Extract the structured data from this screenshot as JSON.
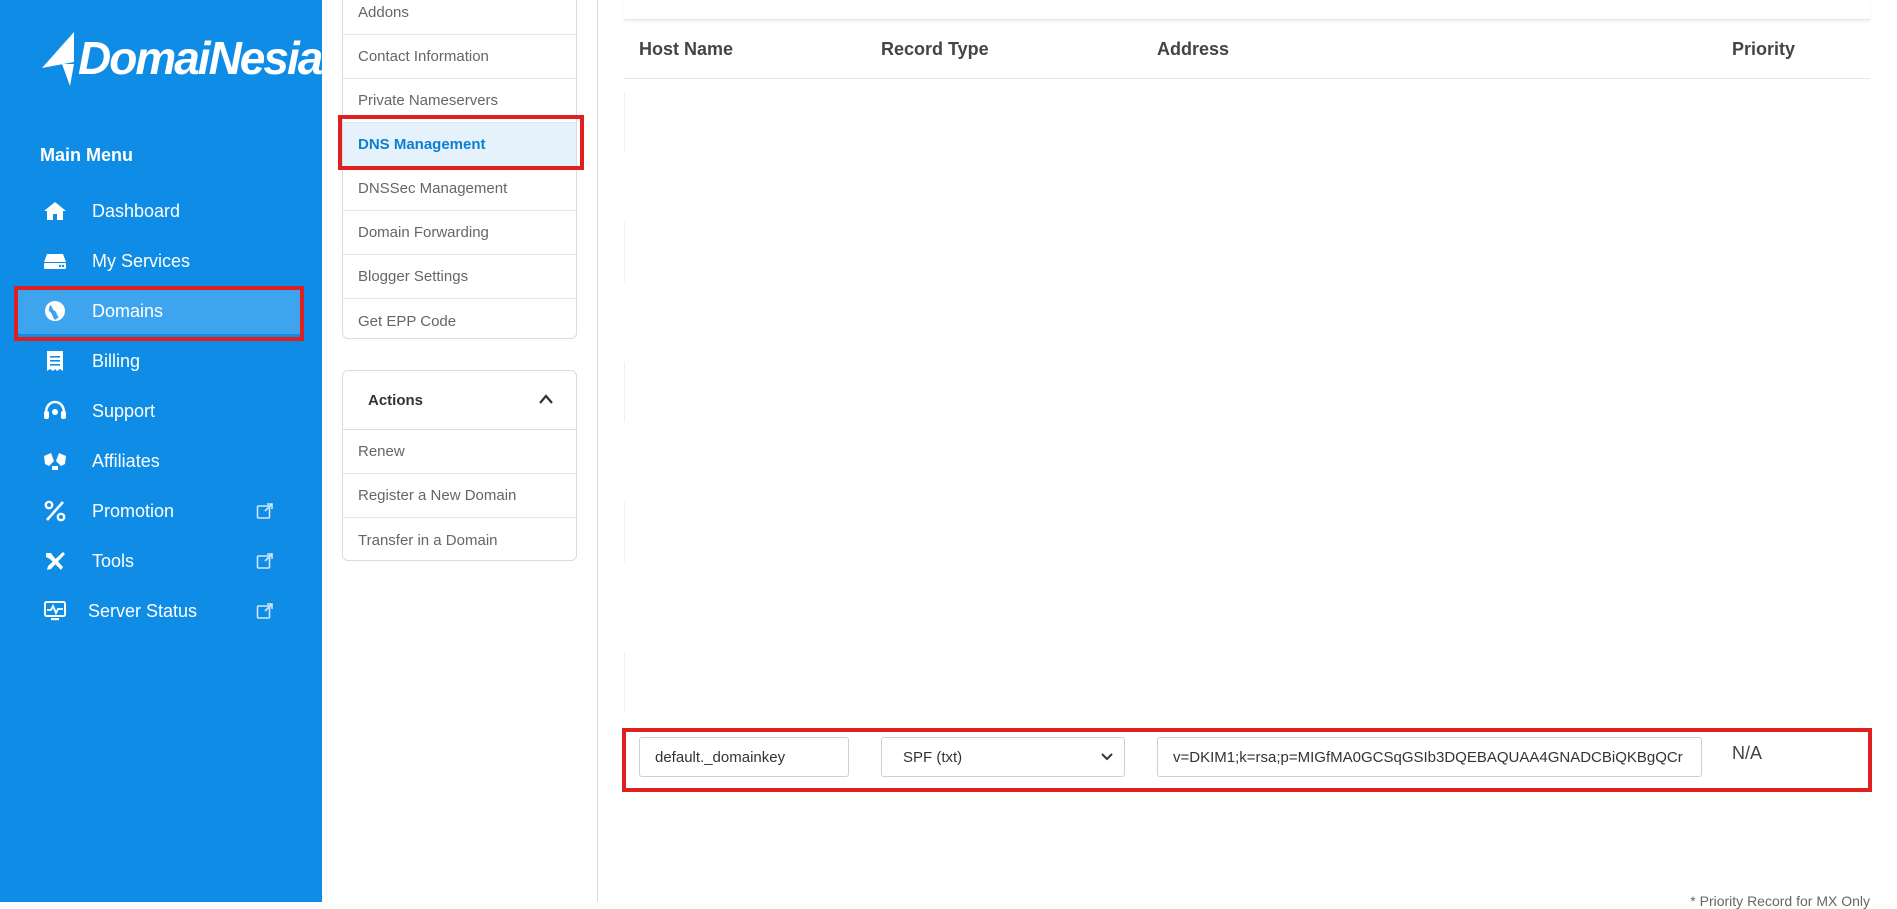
{
  "brand": {
    "name": "DomaiNesia"
  },
  "sidebar": {
    "menu_title": "Main Menu",
    "items": [
      {
        "label": "Dashboard",
        "icon": "home-icon"
      },
      {
        "label": "My Services",
        "icon": "server-icon"
      },
      {
        "label": "Domains",
        "icon": "globe-icon",
        "active": true
      },
      {
        "label": "Billing",
        "icon": "receipt-icon"
      },
      {
        "label": "Support",
        "icon": "headset-icon"
      },
      {
        "label": "Affiliates",
        "icon": "affiliates-icon"
      },
      {
        "label": "Promotion",
        "icon": "percent-icon",
        "external": true
      },
      {
        "label": "Tools",
        "icon": "tools-icon",
        "external": true
      },
      {
        "label": "Server Status",
        "icon": "monitor-icon",
        "external": true
      }
    ]
  },
  "domain_menu": {
    "items": [
      "Addons",
      "Contact Information",
      "Private Nameservers",
      "DNS Management",
      "DNSSec Management",
      "Domain Forwarding",
      "Blogger Settings",
      "Get EPP Code"
    ],
    "active": "DNS Management"
  },
  "actions": {
    "title": "Actions",
    "items": [
      "Renew",
      "Register a New Domain",
      "Transfer in a Domain"
    ]
  },
  "dns_table": {
    "headers": {
      "host": "Host Name",
      "type": "Record Type",
      "address": "Address",
      "priority": "Priority"
    },
    "row": {
      "host": "default._domainkey",
      "type": "SPF (txt)",
      "address": "v=DKIM1;k=rsa;p=MIGfMA0GCSqGSIb3DQEBAQUAA4GNADCBiQKBgQCr",
      "priority": "N/A"
    }
  },
  "footnote": "* Priority Record for MX Only",
  "colors": {
    "sidebar": "#0f8ce6",
    "active_item": "#3fa4ee",
    "highlight": "#e02020",
    "link_active": "#0b7fd1"
  }
}
